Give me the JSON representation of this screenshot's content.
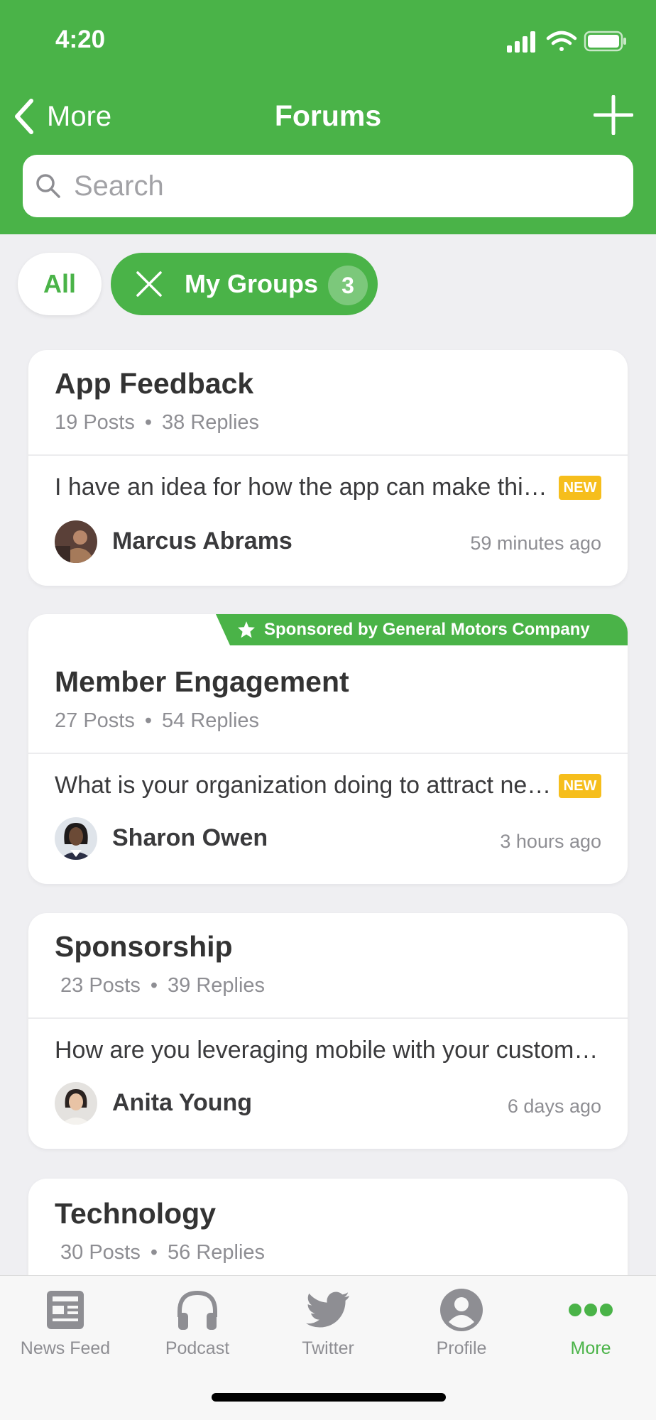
{
  "status": {
    "time": "4:20"
  },
  "header": {
    "back_label": "More",
    "title": "Forums"
  },
  "search": {
    "placeholder": "Search"
  },
  "filters": {
    "all_label": "All",
    "groups_label": "My Groups",
    "groups_count": "3"
  },
  "forums": [
    {
      "name": "App Feedback",
      "posts": "19 Posts",
      "replies": "38 Replies",
      "snippet": "I have an idea for how the app can make things easier for everyone",
      "badge": "NEW",
      "author": "Marcus Abrams",
      "time": "59 minutes ago"
    },
    {
      "sponsor": "Sponsored by General Motors Company",
      "name": "Member Engagement",
      "posts": "27 Posts",
      "replies": "54 Replies",
      "snippet": "What is your organization doing to attract new members this year?",
      "badge": "NEW",
      "author": "Sharon Owen",
      "time": "3 hours ago"
    },
    {
      "name": "Sponsorship",
      "posts": "23 Posts",
      "replies": "39 Replies",
      "snippet": "How are you leveraging mobile with your customers and sponsors?",
      "author": "Anita Young",
      "time": "6 days ago"
    },
    {
      "name": "Technology",
      "posts": "30 Posts",
      "replies": "56 Replies"
    }
  ],
  "tabs": [
    {
      "label": "News Feed",
      "icon": "news-feed-icon"
    },
    {
      "label": "Podcast",
      "icon": "headphones-icon"
    },
    {
      "label": "Twitter",
      "icon": "twitter-bird-icon"
    },
    {
      "label": "Profile",
      "icon": "profile-icon"
    },
    {
      "label": "More",
      "icon": "more-dots-icon",
      "active": true
    }
  ],
  "colors": {
    "brand": "#4ab348",
    "badge": "#f6be1c"
  }
}
